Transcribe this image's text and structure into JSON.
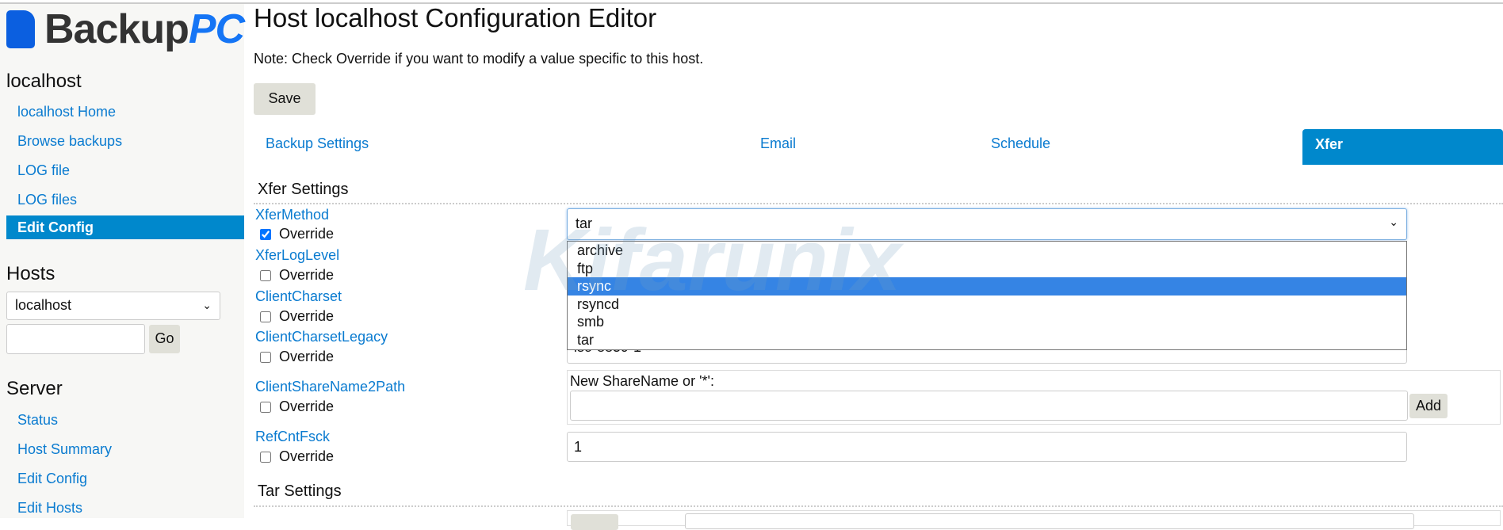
{
  "logo": {
    "text_main": "Backup",
    "text_accent": "PC"
  },
  "sidebar": {
    "host_heading": "localhost",
    "host_links": [
      "localhost Home",
      "Browse backups",
      "LOG file",
      "LOG files"
    ],
    "host_active": "Edit Config",
    "hosts_heading": "Hosts",
    "hosts_select": "localhost",
    "hosts_input": "",
    "go_label": "Go",
    "server_heading": "Server",
    "server_links": [
      "Status",
      "Host Summary",
      "Edit Config",
      "Edit Hosts"
    ]
  },
  "main": {
    "title": "Host localhost Configuration Editor",
    "note": "Note: Check Override if you want to modify a value specific to this host.",
    "save_label": "Save",
    "tabs": [
      "Backup Settings",
      "Email",
      "Schedule",
      "Xfer"
    ],
    "active_tab": "Xfer",
    "xfer_heading": "Xfer Settings",
    "override_label": "Override",
    "fields": [
      "XferMethod",
      "XferLogLevel",
      "ClientCharset",
      "ClientCharsetLegacy",
      "ClientShareName2Path",
      "RefCntFsck"
    ],
    "xfer_method_value": "tar",
    "xfer_method_options": [
      "archive",
      "ftp",
      "rsync",
      "rsyncd",
      "smb",
      "tar"
    ],
    "highlighted_option": "rsync",
    "charset_legacy_value": "iso-8859-1",
    "share_prompt": "New ShareName or '*':",
    "share_input": "",
    "add_label": "Add",
    "refcnt_value": "1",
    "tar_heading": "Tar Settings"
  },
  "watermark": "Kifarunix",
  "colors": {
    "accent": "#0088cc",
    "link": "#0a7bd0",
    "highlight": "#3584e4"
  }
}
